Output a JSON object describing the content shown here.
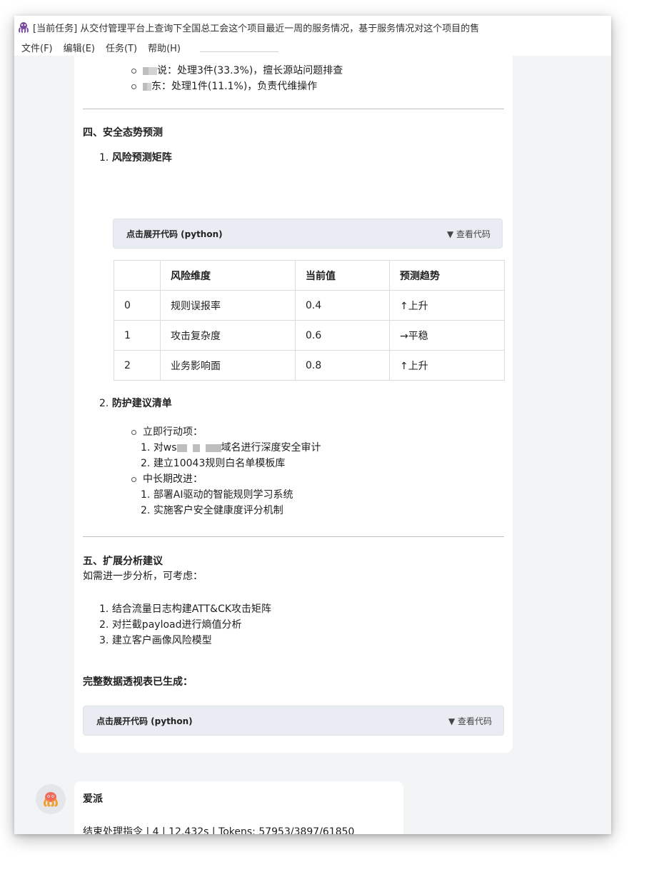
{
  "window": {
    "title": "[当前任务] 从交付管理平台上查询下全国总工会这个项目最近一周的服务情况，基于服务情况对这个项目的售"
  },
  "menu": [
    "文件(F)",
    "编辑(E)",
    "任务(T)",
    "帮助(H)"
  ],
  "staff": [
    {
      "name_end": "说",
      "text": "：处理3件(33.3%)，擅长源站问题排查"
    },
    {
      "name_end": "东",
      "text": "：处理1件(11.1%)，负责代维操作"
    }
  ],
  "section4": {
    "title": "四、安全态势预测",
    "sub1": {
      "num": "1.",
      "title": "风险预测矩阵"
    },
    "code_toggle": {
      "label": "点击展开代码 (python)",
      "action": "▼ 查看代码"
    },
    "table": {
      "headers": [
        "",
        "风险维度",
        "当前值",
        "预测趋势"
      ],
      "rows": [
        [
          "0",
          "规则误报率",
          "0.4",
          "↑上升"
        ],
        [
          "1",
          "攻击复杂度",
          "0.6",
          "→平稳"
        ],
        [
          "2",
          "业务影响面",
          "0.8",
          "↑上升"
        ]
      ]
    },
    "sub2": {
      "num": "2.",
      "title": "防护建议清单"
    },
    "immediate": {
      "label": "立即行动项：",
      "items": [
        {
          "num": "1.",
          "prefix": "对ws",
          "suffix": "域名进行深度安全审计"
        },
        {
          "num": "2.",
          "text": "建立10043规则白名单模板库"
        }
      ]
    },
    "longterm": {
      "label": "中长期改进：",
      "items": [
        {
          "num": "1.",
          "text": "部署AI驱动的智能规则学习系统"
        },
        {
          "num": "2.",
          "text": "实施客户安全健康度评分机制"
        }
      ]
    }
  },
  "section5": {
    "title": "五、扩展分析建议",
    "intro": "如需进一步分析，可考虑：",
    "items": [
      {
        "num": "1.",
        "text": "结合流量日志构建ATT&CK攻击矩阵"
      },
      {
        "num": "2.",
        "text": "对拦截payload进行熵值分析"
      },
      {
        "num": "3.",
        "text": "建立客户画像风险模型"
      }
    ]
  },
  "pivot": {
    "title": "完整数据透视表已生成：",
    "code_toggle": {
      "label": "点击展开代码 (python)",
      "action": "▼ 查看代码"
    }
  },
  "assistant": {
    "name": "爱派",
    "status": "结束处理指令 | 4 | 12.432s | Tokens: 57953/3897/61850"
  }
}
